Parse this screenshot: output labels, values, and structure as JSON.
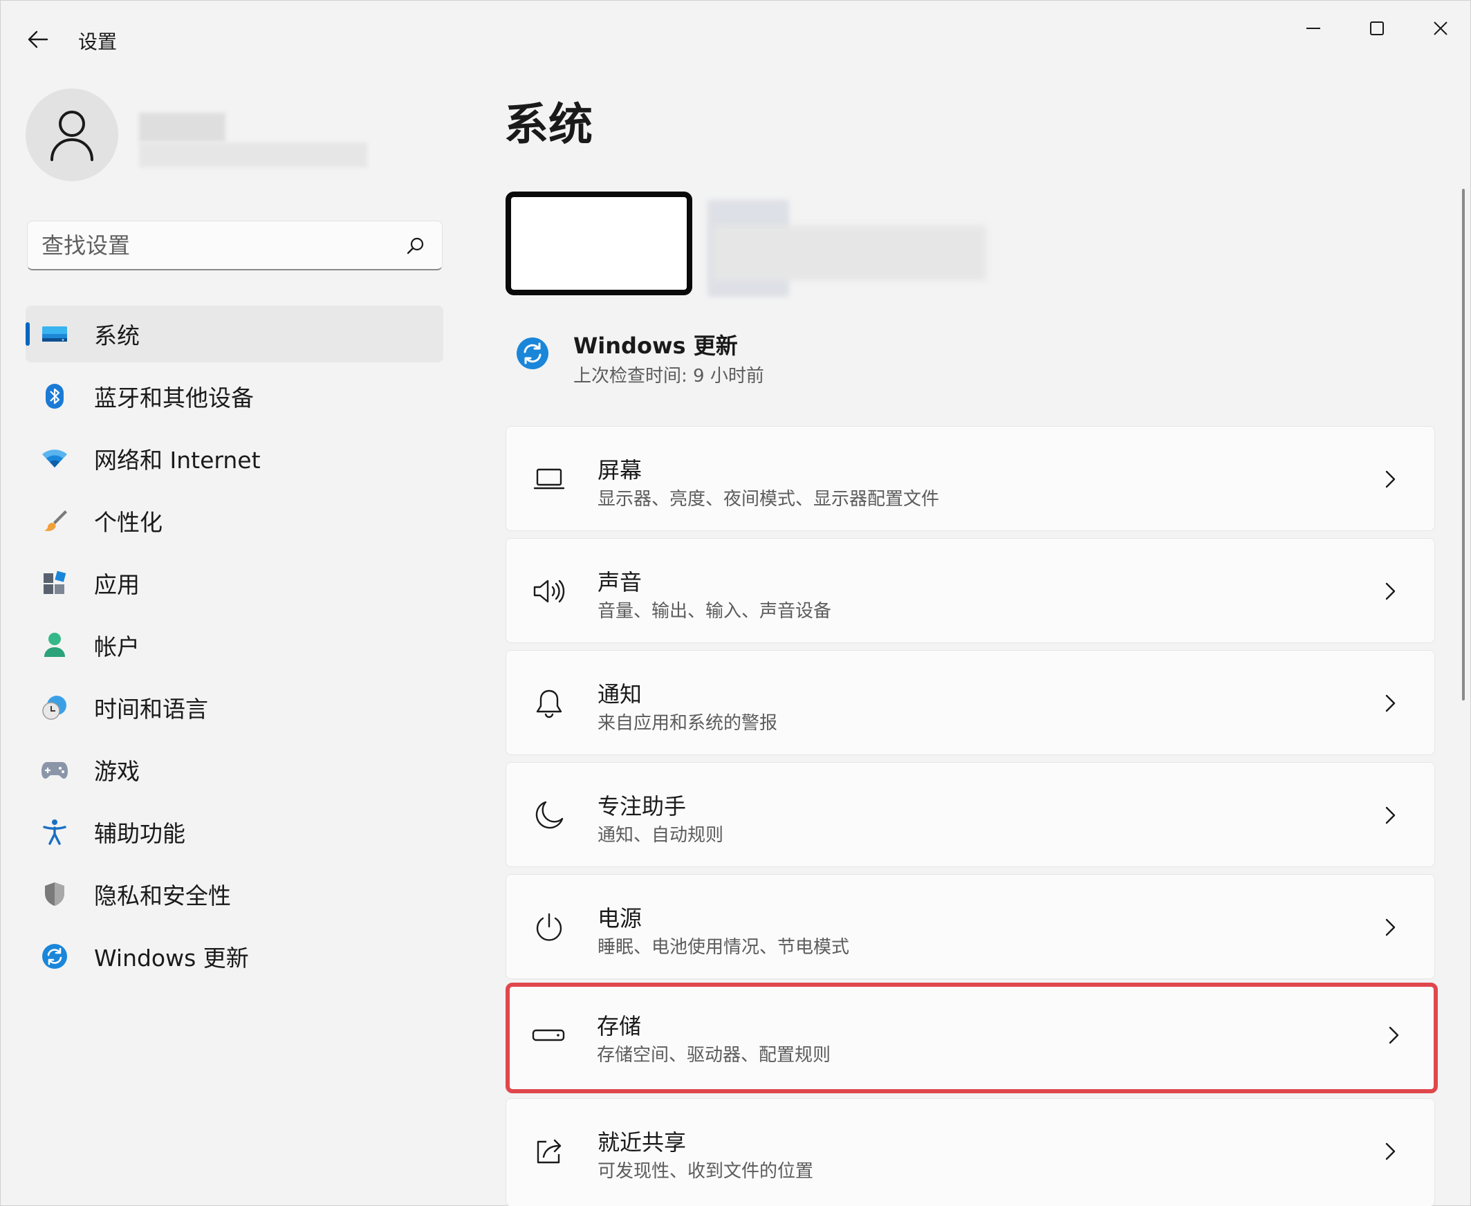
{
  "window": {
    "title": "设置",
    "back_icon": "arrow-left-icon",
    "controls": [
      "minimize-icon",
      "maximize-icon",
      "close-icon"
    ]
  },
  "search": {
    "placeholder": "查找设置",
    "icon": "search-icon"
  },
  "sidebar": {
    "items": [
      {
        "label": "系统",
        "icon": "monitor-icon",
        "active": true
      },
      {
        "label": "蓝牙和其他设备",
        "icon": "bluetooth-icon"
      },
      {
        "label": "网络和 Internet",
        "icon": "wifi-icon"
      },
      {
        "label": "个性化",
        "icon": "paintbrush-icon"
      },
      {
        "label": "应用",
        "icon": "apps-icon"
      },
      {
        "label": "帐户",
        "icon": "person-icon"
      },
      {
        "label": "时间和语言",
        "icon": "clock-globe-icon"
      },
      {
        "label": "游戏",
        "icon": "gamepad-icon"
      },
      {
        "label": "辅助功能",
        "icon": "accessibility-icon"
      },
      {
        "label": "隐私和安全性",
        "icon": "shield-icon"
      },
      {
        "label": "Windows 更新",
        "icon": "windows-update-icon"
      }
    ]
  },
  "main": {
    "title": "系统",
    "update": {
      "title": "Windows 更新",
      "subtitle": "上次检查时间: 9 小时前",
      "icon": "windows-update-icon"
    },
    "cards": [
      {
        "title": "屏幕",
        "subtitle": "显示器、亮度、夜间模式、显示器配置文件",
        "icon": "laptop-icon"
      },
      {
        "title": "声音",
        "subtitle": "音量、输出、输入、声音设备",
        "icon": "speaker-icon"
      },
      {
        "title": "通知",
        "subtitle": "来自应用和系统的警报",
        "icon": "bell-icon"
      },
      {
        "title": "专注助手",
        "subtitle": "通知、自动规则",
        "icon": "moon-icon"
      },
      {
        "title": "电源",
        "subtitle": "睡眠、电池使用情况、节电模式",
        "icon": "power-icon"
      },
      {
        "title": "存储",
        "subtitle": "存储空间、驱动器、配置规则",
        "icon": "storage-drive-icon",
        "highlighted": true
      },
      {
        "title": "就近共享",
        "subtitle": "可发现性、收到文件的位置",
        "icon": "share-icon"
      }
    ]
  },
  "colors": {
    "accent": "#0067c0",
    "highlight_border": "#e0474c",
    "background": "#f3f3f3",
    "card": "#fbfbfb"
  }
}
